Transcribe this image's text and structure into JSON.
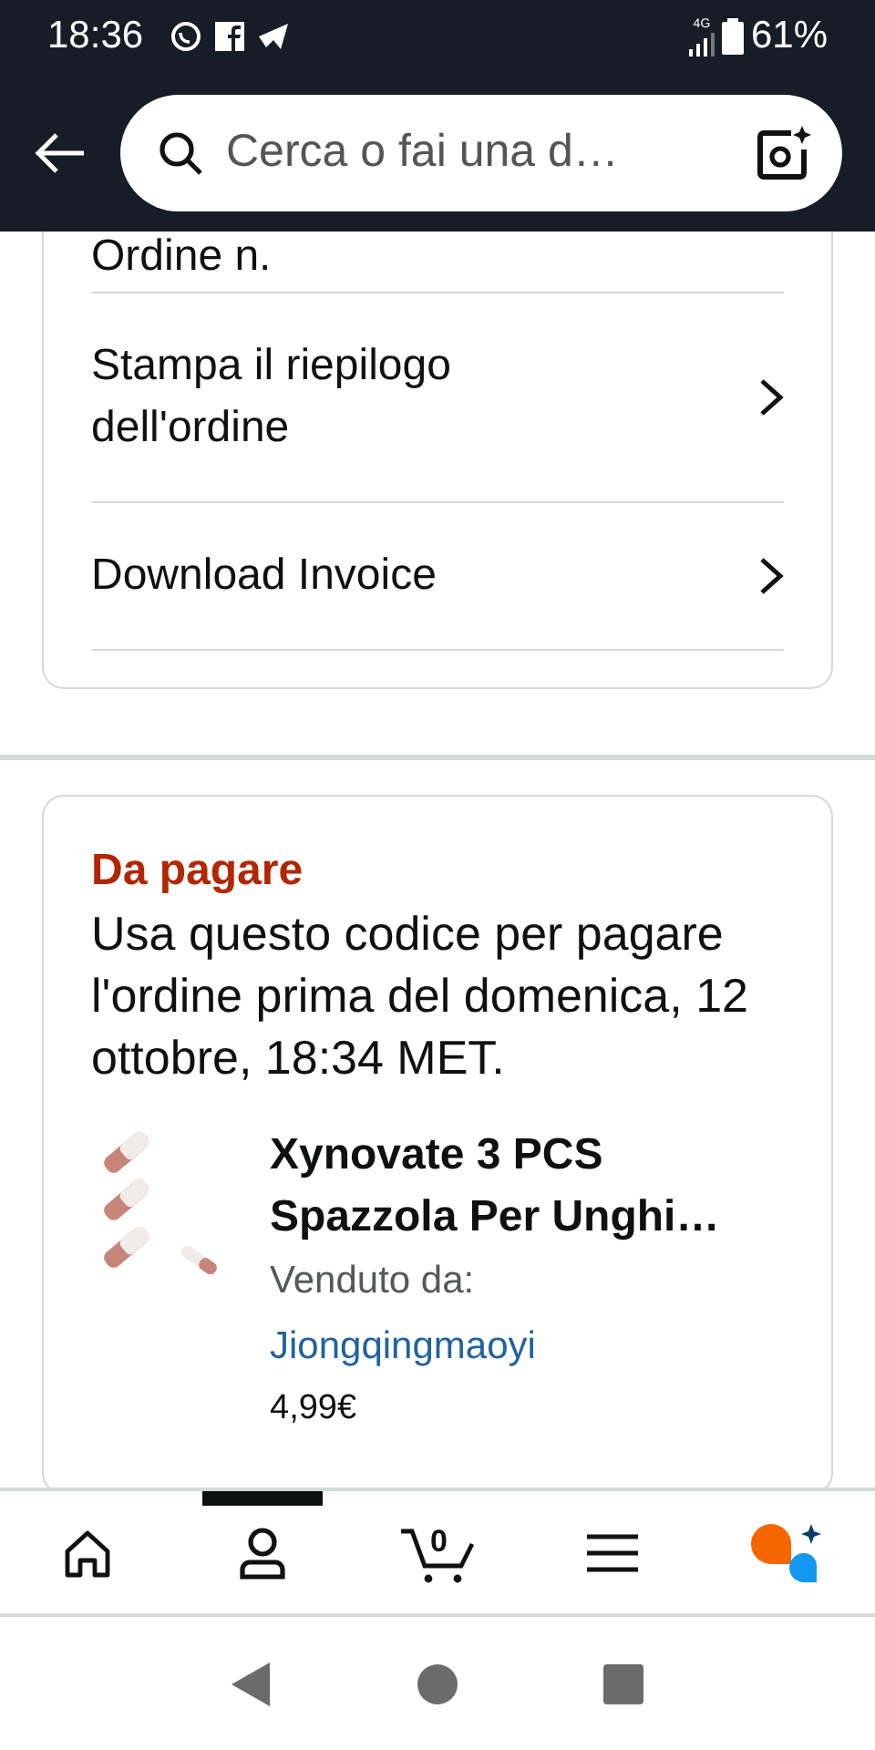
{
  "status_bar": {
    "time": "18:36",
    "network_type": "4G",
    "battery": "61%"
  },
  "search": {
    "placeholder": "Cerca o fai una d…"
  },
  "order_card": {
    "partial_heading": "Ordine n.",
    "links": [
      {
        "label": "Stampa il riepilogo dell'ordine"
      },
      {
        "label": "Download Invoice"
      }
    ]
  },
  "payment_card": {
    "title": "Da pagare",
    "message": "Usa questo codice per pagare l'ordine prima del domenica, 12 ottobre, 18:34 MET.",
    "product": {
      "kind": "picture",
      "title": "Xynovate 3 PCS Spazzola Per Unghi…",
      "sold_by_label": "Venduto da:",
      "seller": "Jiongqingmaoyi",
      "price": "4,99€"
    }
  },
  "bottom_nav": [
    {
      "kind": "home",
      "selected": false
    },
    {
      "kind": "account",
      "selected": true
    },
    {
      "kind": "cart",
      "badge": "0",
      "selected": false
    },
    {
      "kind": "menu",
      "selected": false
    },
    {
      "kind": "assistant",
      "selected": false
    }
  ]
}
